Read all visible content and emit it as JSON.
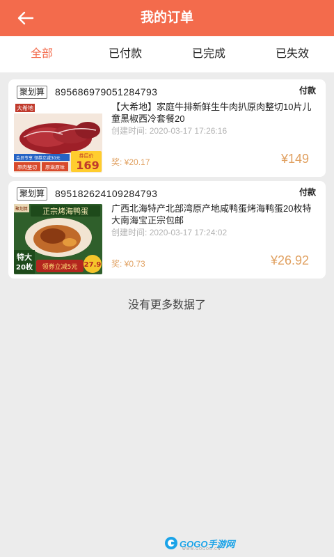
{
  "header": {
    "title": "我的订单"
  },
  "tabs": [
    {
      "label": "全部",
      "active": true
    },
    {
      "label": "已付款",
      "active": false
    },
    {
      "label": "已完成",
      "active": false
    },
    {
      "label": "已失效",
      "active": false
    }
  ],
  "orders": [
    {
      "tag": "聚划算",
      "order_no": "895686979051284793",
      "status": "付款",
      "product_name": "【大希地】家庭牛排新鲜生牛肉扒原肉整切10片儿童黑椒西冷套餐20",
      "created_label": "创建时间:",
      "created_time": "2020-03-17 17:26:16",
      "reward": "奖: ¥20.17",
      "price": "¥149",
      "image": {
        "brand": "大希地",
        "badge": "券后价",
        "price": "169",
        "tag1": "原肉整切",
        "tag2": "原滋原味",
        "promo": "会员专享 领券立减30元"
      }
    },
    {
      "tag": "聚划算",
      "order_no": "895182624109284793",
      "status": "付款",
      "product_name": "广西北海特产北部湾原产地咸鸭蛋烤海鸭蛋20枚特大南海宝正宗包邮",
      "created_label": "创建时间:",
      "created_time": "2020-03-17 17:24:02",
      "reward": "奖: ¥0.73",
      "price": "¥26.92",
      "image": {
        "brand": "聚划算",
        "banner": "正宗烤海鸭蛋",
        "size": "特大",
        "count": "20枚",
        "coupon": "领券立减5元",
        "price": "27.9"
      }
    }
  ],
  "footer": {
    "no_more": "没有更多数据了"
  },
  "watermark": {
    "text": "GOGO手游网",
    "sub": "WWW.GOGOO.CN"
  },
  "colors": {
    "accent": "#f36b4c",
    "price": "#e0a060",
    "muted": "#b3b3b3"
  }
}
